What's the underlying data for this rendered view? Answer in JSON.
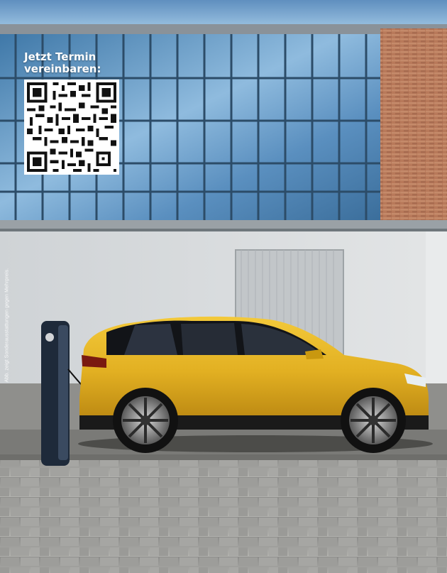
{
  "promo": {
    "qr_title_line1": "Jetzt Termin",
    "qr_title_line2": "vereinbaren:",
    "qr_icon": "qr-code-icon"
  },
  "disclaimer": "Abb. zeigt Sonderausstattungen gegen Mehrpreis.",
  "scene": {
    "subject": "yellow-electric-suv",
    "charger": "ev-charging-station",
    "colors": {
      "sky": "#7fb0d8",
      "car_yellow": "#e3b322",
      "brick": "#b57a5c",
      "wall": "#d7dadd",
      "pavement": "#a9aaa8"
    }
  }
}
